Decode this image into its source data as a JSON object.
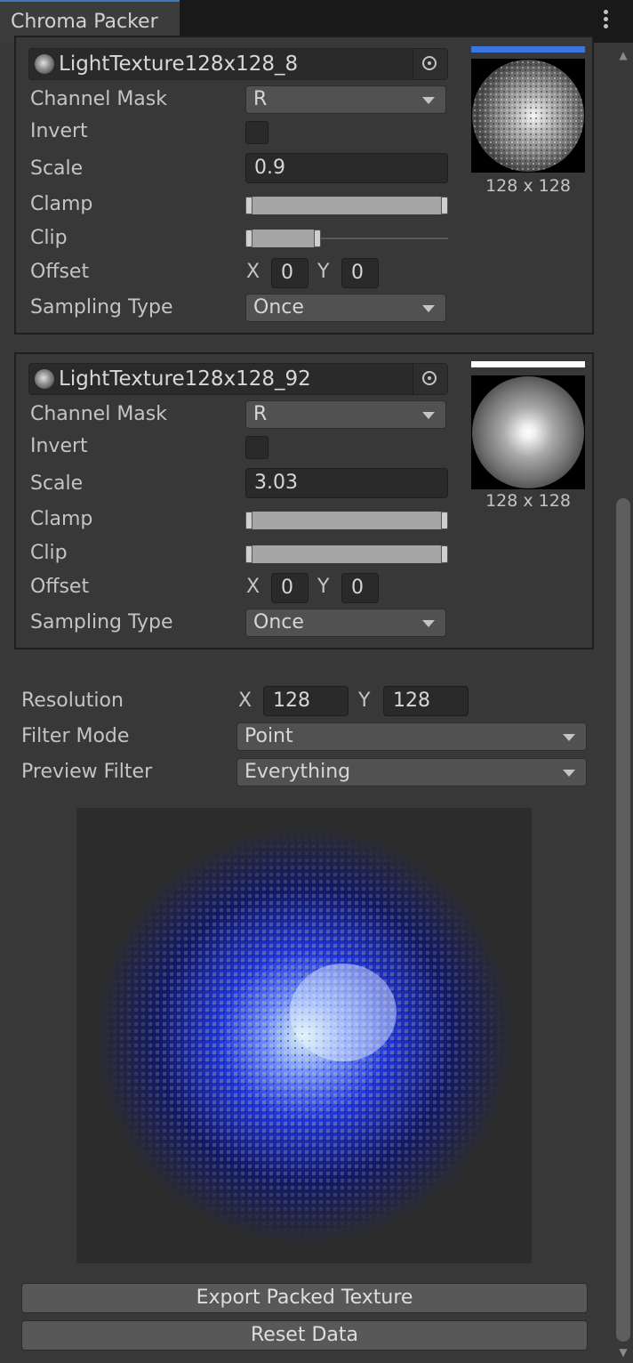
{
  "window": {
    "title": "Chroma Packer"
  },
  "layers": [
    {
      "texture_name": "LightTexture128x128_8",
      "channel_mask_label": "Channel Mask",
      "channel_mask": "R",
      "invert_label": "Invert",
      "invert": false,
      "scale_label": "Scale",
      "scale": "0.9",
      "clamp_label": "Clamp",
      "clamp_range": [
        0.0,
        1.0
      ],
      "clip_label": "Clip",
      "clip_range": [
        0.0,
        0.35
      ],
      "offset_label": "Offset",
      "offset_x_label": "X",
      "offset_x": "0",
      "offset_y_label": "Y",
      "offset_y": "0",
      "sampling_label": "Sampling Type",
      "sampling_type": "Once",
      "preview_dims": "128 x 128",
      "channel_color": "#3a76e0"
    },
    {
      "texture_name": "LightTexture128x128_92",
      "channel_mask_label": "Channel Mask",
      "channel_mask": "R",
      "invert_label": "Invert",
      "invert": false,
      "scale_label": "Scale",
      "scale": "3.03",
      "clamp_label": "Clamp",
      "clamp_range": [
        0.0,
        1.0
      ],
      "clip_label": "Clip",
      "clip_range": [
        0.0,
        1.0
      ],
      "offset_label": "Offset",
      "offset_x_label": "X",
      "offset_x": "0",
      "offset_y_label": "Y",
      "offset_y": "0",
      "sampling_label": "Sampling Type",
      "sampling_type": "Once",
      "preview_dims": "128 x 128",
      "channel_color": "#ffffff"
    }
  ],
  "settings": {
    "resolution_label": "Resolution",
    "res_x_label": "X",
    "res_x": "128",
    "res_y_label": "Y",
    "res_y": "128",
    "filter_mode_label": "Filter Mode",
    "filter_mode": "Point",
    "preview_filter_label": "Preview Filter",
    "preview_filter": "Everything"
  },
  "actions": {
    "export_label": "Export Packed Texture",
    "reset_label": "Reset Data"
  },
  "icons": {
    "menu": "kebab-menu-icon",
    "picker": "object-picker-icon",
    "dropdown": "chevron-down-icon"
  }
}
